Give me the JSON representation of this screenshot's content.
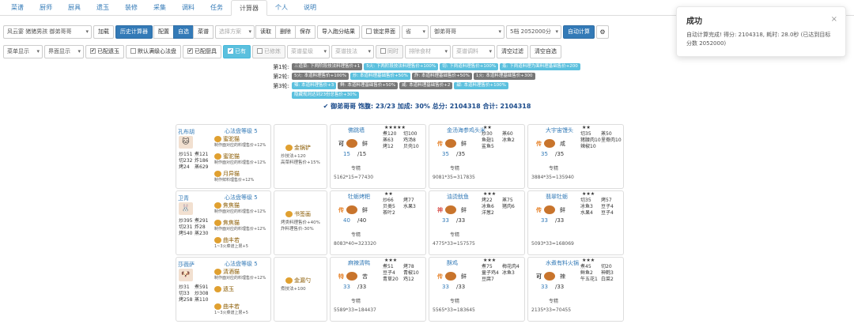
{
  "tabs": [
    "菜谱",
    "厨师",
    "厨具",
    "遗玉",
    "装修",
    "采集",
    "调料",
    "任务",
    "计算器",
    "个人",
    "说明"
  ],
  "active_tab": 8,
  "toolbar": {
    "preset": "风云宴 猪猪男孩 御弟哥哥",
    "load": "加载",
    "history": "历史计算器",
    "config": "配置",
    "self": "自选",
    "recipe": "菜谱",
    "choose_plan": "选择方案",
    "read": "读取",
    "delete": "删除",
    "save": "保存",
    "import_result": "导入跑分结果",
    "lock_ui": "锁定界面",
    "province": "省",
    "chef_sel": "御弟哥哥",
    "level_sel": "5档 2052000分",
    "auto_calc": "自动计算",
    "gear": "⚙"
  },
  "filters": {
    "menu_show": "菜单显示",
    "ui_show": "界面显示",
    "match_relic": "已配遗玉",
    "lvl_cert": "默认满级心法盘",
    "match_tool": "已配厨具",
    "have": "已有",
    "cultivated": "已修炼",
    "recipe_cat": "菜谱星级",
    "recipe_skill": "菜谱技法",
    "same_time": "同时",
    "sort_ing": "排除食材",
    "recipe_seasoning": "菜谱调料",
    "clear_filter": "清空过滤",
    "clear_self": "清空自选"
  },
  "rounds": [
    {
      "label": "第1轮:",
      "tags": [
        {
          "t": "三道菜: 下两阶段技法料理售价+1",
          "c": "dark"
        },
        {
          "t": "5火: 下两阶段技法料理售价+100%",
          "c": "blue"
        },
        {
          "t": "切: 下两道料理售价+100%",
          "c": "blue"
        },
        {
          "t": "蒸: 下两道料理为面料理基础售价+200",
          "c": "blue"
        }
      ]
    },
    {
      "label": "第2轮:",
      "tags": [
        {
          "t": "5火: 本道料理售价+100%",
          "c": "dark"
        },
        {
          "t": "炒: 本道料理基础售价+50%",
          "c": "blue"
        },
        {
          "t": "炸: 本道料理基础售价+50%",
          "c": "dark"
        },
        {
          "t": "1火: 本道料理基础售价+300",
          "c": "dark"
        }
      ]
    },
    {
      "label": "第3轮:",
      "tags": [
        {
          "t": "辣: 本道料理售价+3",
          "c": "blue"
        },
        {
          "t": "鲜: 本道料理基础售价+50%",
          "c": "dark"
        },
        {
          "t": "咸: 本道料理基础售价+2",
          "c": "dark"
        },
        {
          "t": "甜: 本道料理售价+100%",
          "c": "blue"
        }
      ]
    },
    {
      "label": "",
      "tags": [
        {
          "t": "隐藏规则达到23份总售价+30%",
          "c": "blue"
        }
      ]
    }
  ],
  "summary": "✔ 御弟哥哥 饱腹: 23/23 加成: 30% 总分: 2104318 合计: 2104318",
  "chefs": [
    {
      "name": "孔布胡",
      "avatar": "🐱",
      "skill": "心法盘等级 5",
      "stats": [
        "炒151",
        "煮121",
        "切232",
        "炸186",
        "烤24",
        "蒸629"
      ],
      "eq": [
        {
          "n": "蜜驼猫",
          "d": "制作面对应的料理售价+12%"
        },
        {
          "n": "蜜驼猫",
          "d": "制作面对应的料理售价+12%"
        },
        {
          "n": "月异猫",
          "d": "制作鲜料理售价+12%"
        }
      ],
      "tool": {
        "name": "金锅铲",
        "desc": "炒技法+120\n高菜料理售价+15%"
      },
      "dishes": [
        {
          "name": "佛跳墙",
          "star": "★★★★★",
          "cond": [
            "煮120",
            "切100",
            "蒸63",
            "鸡汤8",
            "烤12",
            "贝壳10"
          ],
          "rank": "可",
          "flav": "鲜",
          "qty": "15",
          "max": "/15",
          "skill": "专精",
          "total": "5162*15=77430"
        },
        {
          "name": "金汤海参鸡头米",
          "star": "★★",
          "cond": [
            "炒30",
            "蒸60",
            "鱼翅1",
            "冰鱼2",
            "鲨鱼5",
            ""
          ],
          "rank": "传",
          "flav": "鲜",
          "qty": "35",
          "max": "/35",
          "skill": "专精",
          "total": "9081*35=317835"
        },
        {
          "name": "大宇宙馒头",
          "star": "★★",
          "cond": [
            "切35",
            "蒸50",
            "猪腰肉10",
            "里脊肉10",
            "辣椒10",
            ""
          ],
          "rank": "传",
          "flav": "咸",
          "qty": "35",
          "max": "/35",
          "skill": "专精",
          "total": "3884*35=135940"
        }
      ]
    },
    {
      "name": "卫青",
      "avatar": "🐰",
      "skill": "心法盘等级 5",
      "stats": [
        "炒395",
        "煮291",
        "切231",
        "炸28",
        "烤540",
        "蒸230"
      ],
      "eq": [
        {
          "n": "焦焦猫",
          "d": "制作面对应的料理售价+12%"
        },
        {
          "n": "焦焦猫",
          "d": "制作面对应的料理售价+12%"
        },
        {
          "n": "曲丰若",
          "d": "1~3火菜谱上限+5"
        }
      ],
      "tool": {
        "name": "书签画",
        "desc": "烤类料理售价+40%\n炸料理售价-30%"
      },
      "dishes": [
        {
          "name": "牡蛎烤粑",
          "star": "★★",
          "cond": [
            "炒66",
            "烤77",
            "贝类5",
            "水果3",
            "茶叶2",
            ""
          ],
          "rank": "传",
          "flav": "鲜",
          "qty": "40",
          "max": "/40",
          "skill": "专精",
          "total": "8083*40=323320"
        },
        {
          "name": "油烫鱿鱼",
          "star": "★★★",
          "cond": [
            "烤22",
            "蒸75",
            "冰鱼6",
            "猪肉6",
            "洋葱2",
            ""
          ],
          "rank": "神",
          "flav": "鲜",
          "qty": "33",
          "max": "/33",
          "skill": "专精",
          "total": "4775*33=157575"
        },
        {
          "name": "翡翠牡蛎",
          "star": "★★★",
          "cond": [
            "切35",
            "烤57",
            "冰鱼3",
            "豆子4",
            "水果4",
            "豆子4"
          ],
          "rank": "传",
          "flav": "鲜",
          "qty": "33",
          "max": "/33",
          "skill": "",
          "total": "5093*33=168069"
        }
      ]
    },
    {
      "name": "莎薇萨",
      "avatar": "🐶",
      "skill": "心法盘等级 5",
      "stats": [
        "炒31",
        "煮591",
        "切33",
        "炒308",
        "烤258",
        "蒸110"
      ],
      "eq": [
        {
          "n": "清酒猫",
          "d": "制作面对应的料理售价+12%"
        },
        {
          "n": "遗玉",
          "d": ""
        },
        {
          "n": "曲丰若",
          "d": "1~3火菜谱上限+5"
        }
      ],
      "tool": {
        "name": "金漏勺",
        "desc": "煮技法+100"
      },
      "dishes": [
        {
          "name": "麻辣清鸭",
          "star": "★★★",
          "cond": [
            "煮51",
            "烤78",
            "豆子4",
            "青椒10",
            "青草20",
            "鸡12"
          ],
          "rank": "特",
          "flav": "苦",
          "qty": "33",
          "max": "/33",
          "skill": "专精",
          "total": "5589*33=184437"
        },
        {
          "name": "酥鸡",
          "star": "★★★",
          "cond": [
            "煮75",
            "梅花肉4",
            "童子鸡4",
            "冰鱼3",
            "豆腐7",
            ""
          ],
          "rank": "传",
          "flav": "鲜",
          "qty": "33",
          "max": "/33",
          "skill": "专精",
          "total": "5565*33=183645"
        },
        {
          "name": "水煮有料火锅",
          "star": "★★★",
          "cond": [
            "煮45",
            "切20",
            "鲜鱼2",
            "神鹤3",
            "午五花1",
            "白菜2"
          ],
          "rank": "可",
          "flav": "辣",
          "qty": "33",
          "max": "/33",
          "skill": "专精",
          "total": "2135*33=70455"
        }
      ]
    }
  ],
  "toast": {
    "title": "成功",
    "body": "自动计算完成! 得分: 2104318, 耗时: 28.0秒 (已达到目标分数 2052000)",
    "close": "×"
  }
}
